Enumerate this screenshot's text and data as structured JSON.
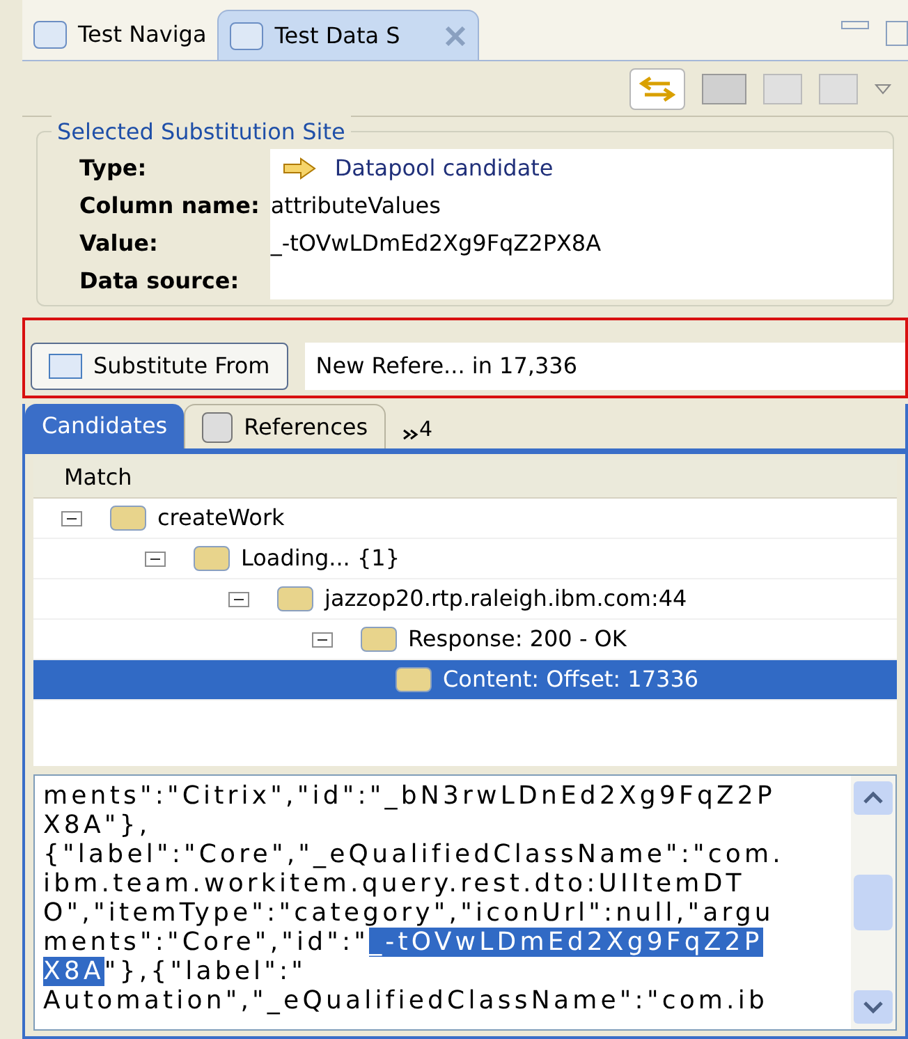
{
  "view_tabs": [
    {
      "label": "Test Naviga",
      "selected": false,
      "closable": false
    },
    {
      "label": "Test Data S",
      "selected": true,
      "closable": true
    }
  ],
  "site": {
    "title": "Selected Substitution Site",
    "fields": [
      {
        "label": "Type:",
        "value": "Datapool candidate",
        "kind": "type"
      },
      {
        "label": "Column name:",
        "value": "attributeValues",
        "kind": "text"
      },
      {
        "label": "Value:",
        "value": "_-tOVwLDmEd2Xg9FqZ2PX8A",
        "kind": "text"
      },
      {
        "label": "Data source:",
        "kind": "text"
      }
    ]
  },
  "substitute_button": "Substitute From",
  "substitute_info": "New Refere... in 17,336",
  "lower_tabs": [
    {
      "label": "Candidates",
      "selected": true
    },
    {
      "label": "References",
      "selected": false
    }
  ],
  "more_tabs": "4",
  "tree": {
    "column": "Match",
    "items": [
      {
        "label": "createWork",
        "expanded": true,
        "selected": false,
        "children": [
          {
            "label": "Loading... {1}",
            "expanded": true,
            "selected": false,
            "children": [
              {
                "label": "jazzop20.rtp.raleigh.ibm.com:44",
                "expanded": true,
                "selected": false,
                "children": [
                  {
                    "label": "Response: 200 - OK",
                    "expanded": true,
                    "selected": false,
                    "children": [
                      {
                        "label": "Content: Offset: 17336",
                        "selected": true
                      }
                    ]
                  }
                ]
              }
            ]
          }
        ]
      }
    ]
  },
  "content_lines": [
    [
      {
        "text": "ments\":\"Citrix\",\"id\":\"_bN3rwLDnEd2Xg9FqZ2P",
        "selected": false
      }
    ],
    [
      {
        "text": "X8A\"},",
        "selected": false
      }
    ],
    [
      {
        "text": "{\"label\":\"Core\",\"_eQualifiedClassName\":\"com.",
        "selected": false
      }
    ],
    [
      {
        "text": "ibm.team.workitem.query.rest.dto:UIItemDT",
        "selected": false
      }
    ],
    [
      {
        "text": "O\",\"itemType\":\"category\",\"iconUrl\":null,\"argu",
        "selected": false
      }
    ],
    [
      {
        "text": "ments\":\"Core\",\"id\":\"",
        "selected": false
      },
      {
        "text": "_-tOVwLDmEd2Xg9FqZ2P",
        "selected": true
      }
    ],
    [
      {
        "text": "X8A",
        "selected": true
      },
      {
        "text": "\"},{\"label\":\"",
        "selected": false
      }
    ],
    [
      {
        "text": "Automation\",\"_eQualifiedClassName\":\"com.ib",
        "selected": false
      }
    ]
  ]
}
